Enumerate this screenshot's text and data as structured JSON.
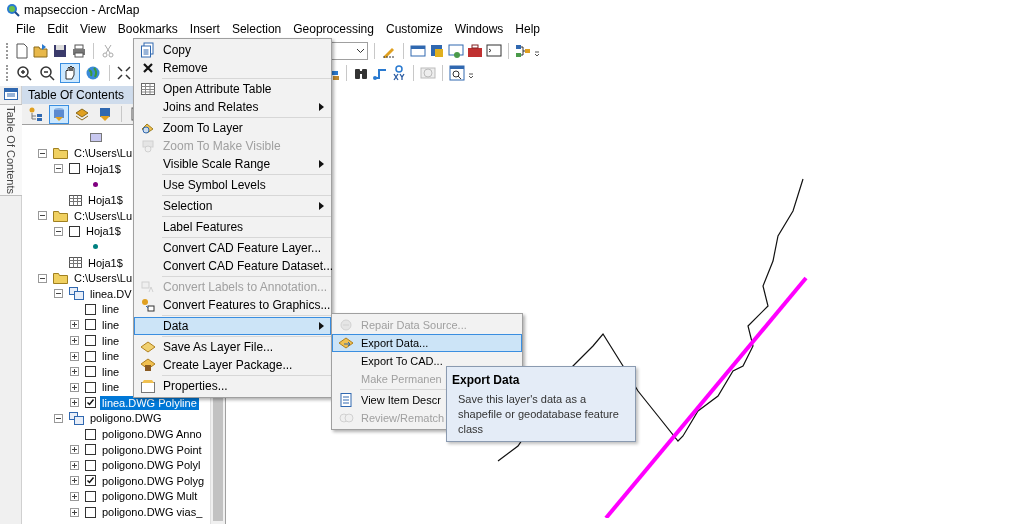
{
  "window": {
    "title": "mapseccion - ArcMap"
  },
  "menu_bar": [
    "File",
    "Edit",
    "View",
    "Bookmarks",
    "Insert",
    "Selection",
    "Geoprocessing",
    "Customize",
    "Windows",
    "Help"
  ],
  "navigation_tools": [
    {
      "selected": false
    },
    {
      "selected": false
    },
    {
      "selected": true
    },
    {
      "selected": false
    }
  ],
  "toc": {
    "side_tab": "Table Of Contents",
    "title": "Table Of Contents",
    "view_buttons": [
      {
        "selected": false
      },
      {
        "selected": true
      },
      {
        "selected": false
      },
      {
        "selected": false
      },
      {
        "selected": false
      }
    ],
    "scrolled_symbol": {
      "color": "#c8c8f0"
    },
    "tree": [
      {
        "kind": "folder",
        "label": "C:\\Users\\Lu",
        "expanded": true,
        "selected": false,
        "children": [
          {
            "kind": "layer",
            "label": "Hoja1$",
            "expanded": true,
            "checked": false,
            "selected": false,
            "children": [
              {
                "kind": "symbol",
                "color": "#800080"
              }
            ]
          },
          {
            "kind": "table",
            "label": "Hoja1$",
            "selected": false
          }
        ]
      },
      {
        "kind": "folder",
        "label": "C:\\Users\\Lu",
        "expanded": true,
        "selected": false,
        "children": [
          {
            "kind": "layer",
            "label": "Hoja1$",
            "expanded": true,
            "checked": false,
            "selected": false,
            "children": [
              {
                "kind": "symbol",
                "color": "#008080"
              }
            ]
          },
          {
            "kind": "table",
            "label": "Hoja1$",
            "selected": false
          }
        ]
      },
      {
        "kind": "folder",
        "label": "C:\\Users\\Lu",
        "expanded": true,
        "selected": false,
        "children": [
          {
            "kind": "group",
            "label": "linea.DV",
            "expanded": true,
            "selected": false,
            "children": [
              {
                "kind": "layer",
                "label": "line",
                "checked": false,
                "selected": false
              },
              {
                "kind": "layer",
                "label": "line",
                "expanded": false,
                "checked": false,
                "selected": false
              },
              {
                "kind": "layer",
                "label": "line",
                "expanded": false,
                "checked": false,
                "selected": false
              },
              {
                "kind": "layer",
                "label": "line",
                "expanded": false,
                "checked": false,
                "selected": false
              },
              {
                "kind": "layer",
                "label": "line",
                "expanded": false,
                "checked": false,
                "selected": false
              },
              {
                "kind": "layer",
                "label": "line",
                "expanded": false,
                "checked": false,
                "selected": false
              },
              {
                "kind": "layer",
                "label": "linea.DWG Polyline",
                "expanded": false,
                "checked": true,
                "selected": true
              }
            ]
          },
          {
            "kind": "group",
            "label": "poligono.DWG",
            "expanded": true,
            "selected": false,
            "children": [
              {
                "kind": "layer",
                "label": "poligono.DWG Anno",
                "checked": false,
                "selected": false
              },
              {
                "kind": "layer",
                "label": "poligono.DWG Point",
                "expanded": false,
                "checked": false,
                "selected": false
              },
              {
                "kind": "layer",
                "label": "poligono.DWG Polyl",
                "expanded": false,
                "checked": false,
                "selected": false
              },
              {
                "kind": "layer",
                "label": "poligono.DWG Polyg",
                "expanded": false,
                "checked": true,
                "selected": false
              },
              {
                "kind": "layer",
                "label": "poligono.DWG Mult",
                "expanded": false,
                "checked": false,
                "selected": false
              },
              {
                "kind": "layer",
                "label": "poligono.DWG vias_",
                "expanded": false,
                "checked": false,
                "selected": false
              }
            ]
          }
        ]
      }
    ]
  },
  "context_menu": {
    "groups": [
      [
        {
          "label": "Copy",
          "disabled": false,
          "submenu": false,
          "selected": false
        },
        {
          "label": "Remove",
          "disabled": false,
          "submenu": false,
          "selected": false
        }
      ],
      [
        {
          "label": "Open Attribute Table",
          "disabled": false,
          "submenu": false,
          "selected": false
        },
        {
          "label": "Joins and Relates",
          "disabled": false,
          "submenu": true,
          "selected": false
        }
      ],
      [
        {
          "label": "Zoom To Layer",
          "disabled": false,
          "submenu": false,
          "selected": false
        },
        {
          "label": "Zoom To Make Visible",
          "disabled": true,
          "submenu": false,
          "selected": false
        },
        {
          "label": "Visible Scale Range",
          "disabled": false,
          "submenu": true,
          "selected": false
        }
      ],
      [
        {
          "label": "Use Symbol Levels",
          "disabled": false,
          "submenu": false,
          "selected": false
        }
      ],
      [
        {
          "label": "Selection",
          "disabled": false,
          "submenu": true,
          "selected": false
        }
      ],
      [
        {
          "label": "Label Features",
          "disabled": false,
          "submenu": false,
          "selected": false
        }
      ],
      [
        {
          "label": "Convert CAD Feature Layer...",
          "disabled": false,
          "submenu": false,
          "selected": false
        },
        {
          "label": "Convert CAD Feature Dataset...",
          "disabled": false,
          "submenu": false,
          "selected": false
        }
      ],
      [
        {
          "label": "Convert Labels to Annotation...",
          "disabled": true,
          "submenu": false,
          "selected": false
        },
        {
          "label": "Convert Features to Graphics...",
          "disabled": false,
          "submenu": false,
          "selected": false
        }
      ],
      [
        {
          "label": "Data",
          "disabled": false,
          "submenu": true,
          "selected": true
        }
      ],
      [
        {
          "label": "Save As Layer File...",
          "disabled": false,
          "submenu": false,
          "selected": false
        },
        {
          "label": "Create Layer Package...",
          "disabled": false,
          "submenu": false,
          "selected": false
        }
      ],
      [
        {
          "label": "Properties...",
          "disabled": false,
          "submenu": false,
          "selected": false
        }
      ]
    ]
  },
  "submenu": {
    "groups": [
      [
        {
          "label": "Repair Data Source...",
          "disabled": true,
          "submenu": false,
          "selected": false
        },
        {
          "label": "Export Data...",
          "disabled": false,
          "submenu": false,
          "selected": true
        },
        {
          "label": "Export To CAD...",
          "disabled": false,
          "submenu": false,
          "selected": false
        },
        {
          "label": "Make Permanen",
          "disabled": true,
          "submenu": false,
          "selected": false
        }
      ],
      [
        {
          "label": "View Item Descr",
          "disabled": false,
          "submenu": false,
          "selected": false
        },
        {
          "label": "Review/Rematch",
          "disabled": true,
          "submenu": false,
          "selected": false
        }
      ]
    ]
  },
  "tooltip": {
    "title": "Export Data",
    "text": "Save this layer's data as a shapefile or geodatabase feature class"
  }
}
